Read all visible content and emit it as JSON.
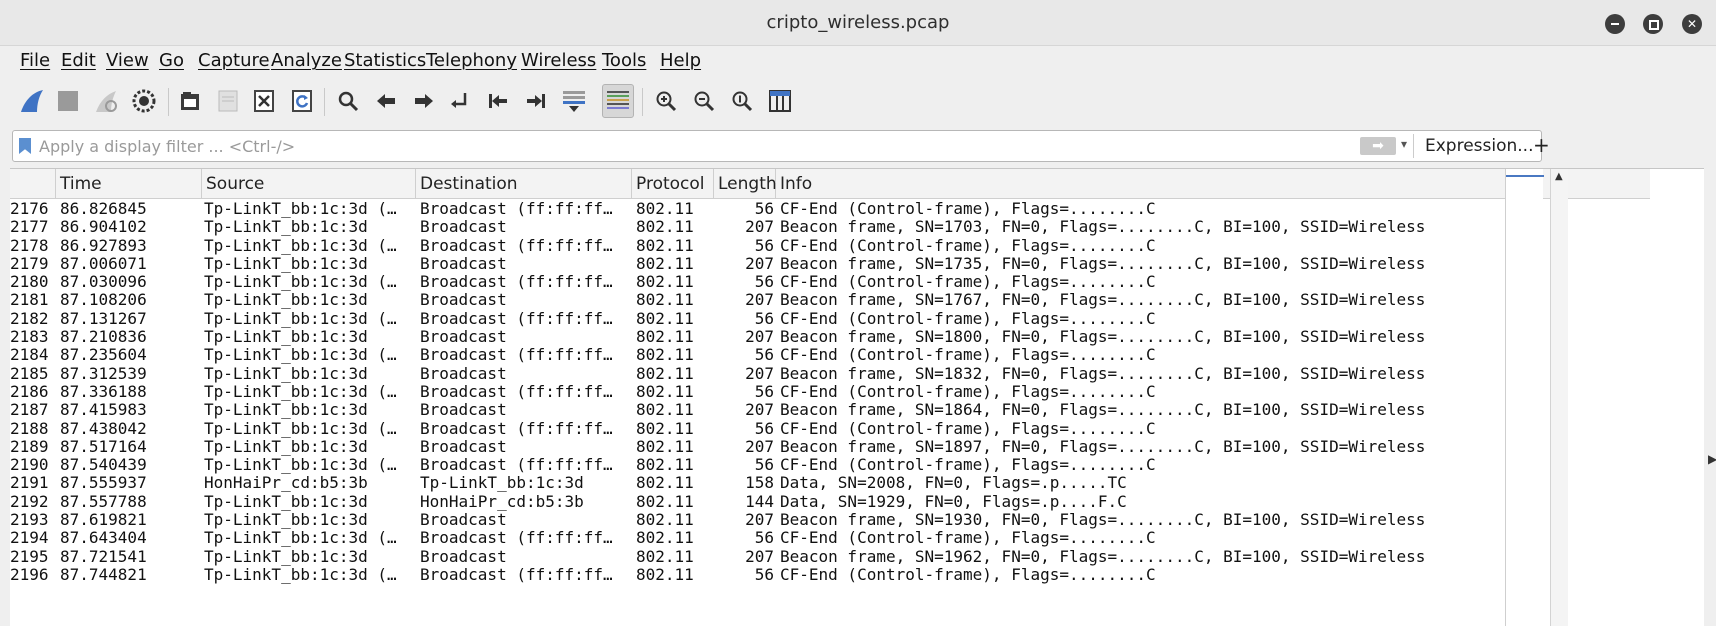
{
  "window": {
    "title": "cripto_wireless.pcap",
    "controls": [
      "minimize",
      "maximize",
      "close"
    ]
  },
  "menu": [
    "File",
    "Edit",
    "View",
    "Go",
    "Capture",
    "Analyze",
    "Statistics",
    "Telephony",
    "Wireless",
    "Tools",
    "Help"
  ],
  "toolbar": {
    "icons": [
      "shark-fin-icon",
      "stop-icon",
      "restart-icon",
      "options-gear-icon",
      "open-folder-icon",
      "save-file-icon",
      "close-file-icon",
      "reload-icon",
      "find-icon",
      "back-arrow-icon",
      "forward-arrow-icon",
      "goto-packet-icon",
      "first-packet-icon",
      "last-packet-icon",
      "autoscroll-icon",
      "colorize-icon",
      "zoom-in-icon",
      "zoom-out-icon",
      "normal-size-icon",
      "resize-columns-icon"
    ]
  },
  "filter": {
    "placeholder": "Apply a display filter ... <Ctrl-/>",
    "value": "",
    "expression_label": "Expression...",
    "add_label": "+"
  },
  "columns": {
    "no": "",
    "time": "Time",
    "source": "Source",
    "destination": "Destination",
    "protocol": "Protocol",
    "length": "Length",
    "info": "Info"
  },
  "packets": [
    {
      "no": "2176",
      "time": "86.826845",
      "src": "Tp-LinkT_bb:1c:3d (…",
      "dst": "Broadcast (ff:ff:ff…",
      "proto": "802.11",
      "len": "56",
      "info": "CF-End (Control-frame), Flags=........C"
    },
    {
      "no": "2177",
      "time": "86.904102",
      "src": "Tp-LinkT_bb:1c:3d",
      "dst": "Broadcast",
      "proto": "802.11",
      "len": "207",
      "info": "Beacon frame, SN=1703, FN=0, Flags=........C, BI=100, SSID=Wireless"
    },
    {
      "no": "2178",
      "time": "86.927893",
      "src": "Tp-LinkT_bb:1c:3d (…",
      "dst": "Broadcast (ff:ff:ff…",
      "proto": "802.11",
      "len": "56",
      "info": "CF-End (Control-frame), Flags=........C"
    },
    {
      "no": "2179",
      "time": "87.006071",
      "src": "Tp-LinkT_bb:1c:3d",
      "dst": "Broadcast",
      "proto": "802.11",
      "len": "207",
      "info": "Beacon frame, SN=1735, FN=0, Flags=........C, BI=100, SSID=Wireless"
    },
    {
      "no": "2180",
      "time": "87.030096",
      "src": "Tp-LinkT_bb:1c:3d (…",
      "dst": "Broadcast (ff:ff:ff…",
      "proto": "802.11",
      "len": "56",
      "info": "CF-End (Control-frame), Flags=........C"
    },
    {
      "no": "2181",
      "time": "87.108206",
      "src": "Tp-LinkT_bb:1c:3d",
      "dst": "Broadcast",
      "proto": "802.11",
      "len": "207",
      "info": "Beacon frame, SN=1767, FN=0, Flags=........C, BI=100, SSID=Wireless"
    },
    {
      "no": "2182",
      "time": "87.131267",
      "src": "Tp-LinkT_bb:1c:3d (…",
      "dst": "Broadcast (ff:ff:ff…",
      "proto": "802.11",
      "len": "56",
      "info": "CF-End (Control-frame), Flags=........C"
    },
    {
      "no": "2183",
      "time": "87.210836",
      "src": "Tp-LinkT_bb:1c:3d",
      "dst": "Broadcast",
      "proto": "802.11",
      "len": "207",
      "info": "Beacon frame, SN=1800, FN=0, Flags=........C, BI=100, SSID=Wireless"
    },
    {
      "no": "2184",
      "time": "87.235604",
      "src": "Tp-LinkT_bb:1c:3d (…",
      "dst": "Broadcast (ff:ff:ff…",
      "proto": "802.11",
      "len": "56",
      "info": "CF-End (Control-frame), Flags=........C"
    },
    {
      "no": "2185",
      "time": "87.312539",
      "src": "Tp-LinkT_bb:1c:3d",
      "dst": "Broadcast",
      "proto": "802.11",
      "len": "207",
      "info": "Beacon frame, SN=1832, FN=0, Flags=........C, BI=100, SSID=Wireless"
    },
    {
      "no": "2186",
      "time": "87.336188",
      "src": "Tp-LinkT_bb:1c:3d (…",
      "dst": "Broadcast (ff:ff:ff…",
      "proto": "802.11",
      "len": "56",
      "info": "CF-End (Control-frame), Flags=........C"
    },
    {
      "no": "2187",
      "time": "87.415983",
      "src": "Tp-LinkT_bb:1c:3d",
      "dst": "Broadcast",
      "proto": "802.11",
      "len": "207",
      "info": "Beacon frame, SN=1864, FN=0, Flags=........C, BI=100, SSID=Wireless"
    },
    {
      "no": "2188",
      "time": "87.438042",
      "src": "Tp-LinkT_bb:1c:3d (…",
      "dst": "Broadcast (ff:ff:ff…",
      "proto": "802.11",
      "len": "56",
      "info": "CF-End (Control-frame), Flags=........C"
    },
    {
      "no": "2189",
      "time": "87.517164",
      "src": "Tp-LinkT_bb:1c:3d",
      "dst": "Broadcast",
      "proto": "802.11",
      "len": "207",
      "info": "Beacon frame, SN=1897, FN=0, Flags=........C, BI=100, SSID=Wireless"
    },
    {
      "no": "2190",
      "time": "87.540439",
      "src": "Tp-LinkT_bb:1c:3d (…",
      "dst": "Broadcast (ff:ff:ff…",
      "proto": "802.11",
      "len": "56",
      "info": "CF-End (Control-frame), Flags=........C"
    },
    {
      "no": "2191",
      "time": "87.555937",
      "src": "HonHaiPr_cd:b5:3b",
      "dst": "Tp-LinkT_bb:1c:3d",
      "proto": "802.11",
      "len": "158",
      "info": "Data, SN=2008, FN=0, Flags=.p.....TC"
    },
    {
      "no": "2192",
      "time": "87.557788",
      "src": "Tp-LinkT_bb:1c:3d",
      "dst": "HonHaiPr_cd:b5:3b",
      "proto": "802.11",
      "len": "144",
      "info": "Data, SN=1929, FN=0, Flags=.p....F.C"
    },
    {
      "no": "2193",
      "time": "87.619821",
      "src": "Tp-LinkT_bb:1c:3d",
      "dst": "Broadcast",
      "proto": "802.11",
      "len": "207",
      "info": "Beacon frame, SN=1930, FN=0, Flags=........C, BI=100, SSID=Wireless"
    },
    {
      "no": "2194",
      "time": "87.643404",
      "src": "Tp-LinkT_bb:1c:3d (…",
      "dst": "Broadcast (ff:ff:ff…",
      "proto": "802.11",
      "len": "56",
      "info": "CF-End (Control-frame), Flags=........C"
    },
    {
      "no": "2195",
      "time": "87.721541",
      "src": "Tp-LinkT_bb:1c:3d",
      "dst": "Broadcast",
      "proto": "802.11",
      "len": "207",
      "info": "Beacon frame, SN=1962, FN=0, Flags=........C, BI=100, SSID=Wireless"
    },
    {
      "no": "2196",
      "time": "87.744821",
      "src": "Tp-LinkT_bb:1c:3d (…",
      "dst": "Broadcast (ff:ff:ff…",
      "proto": "802.11",
      "len": "56",
      "info": "CF-End (Control-frame), Flags=........C"
    }
  ],
  "colors": {
    "window_bg": "#efefef",
    "list_bg": "#ffffff",
    "accent": "#4a78c2"
  }
}
